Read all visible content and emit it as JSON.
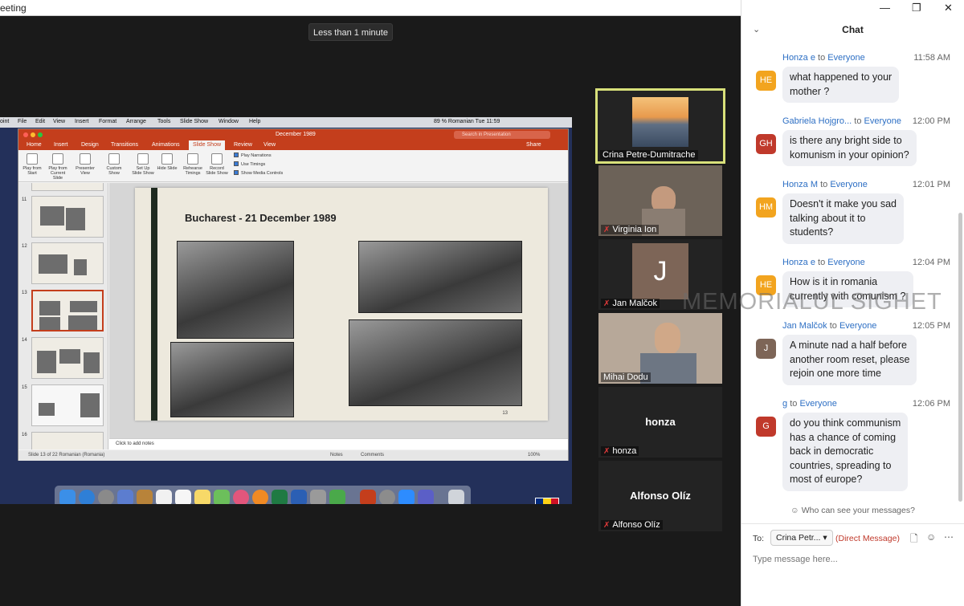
{
  "window": {
    "title": "eeting",
    "minimize": "—",
    "maximize": "❐",
    "close": "✕"
  },
  "timer": "Less than 1 minute",
  "share": {
    "mac_menu": [
      "oint",
      "File",
      "Edit",
      "View",
      "Insert",
      "Format",
      "Arrange",
      "Tools",
      "Slide Show",
      "Window",
      "Help"
    ],
    "mac_status": "89 %  Romanian   Tue 11:59",
    "ppt_title": "December 1989",
    "ppt_search": "Search in Presentation",
    "ppt_tabs": [
      "Home",
      "Insert",
      "Design",
      "Transitions",
      "Animations",
      "Slide Show",
      "Review",
      "View"
    ],
    "ppt_share": "Share",
    "ribbon": [
      "Play from Start",
      "Play from Current Slide",
      "Presenter View",
      "Custom Show",
      "Set Up Slide Show",
      "Hide Slide",
      "Rehearse Timings",
      "Record Slide Show"
    ],
    "checks": [
      "Play Narrations",
      "Use Timings",
      "Show Media Controls"
    ],
    "thumb_numbers": [
      "11",
      "12",
      "13",
      "14",
      "15",
      "16"
    ],
    "slide_title": "Bucharest - 21 December 1989",
    "slide_number": "13",
    "notes_placeholder": "Click to add notes",
    "status_left": "Slide 13 of 22     Romanian (Romania)",
    "status_notes": "Notes",
    "status_comments": "Comments",
    "zoom": "100%"
  },
  "tiles": [
    {
      "name": "Crina Petre-Dumitrache",
      "muted": false
    },
    {
      "name": "Virginia Ion",
      "muted": true
    },
    {
      "name": "Jan Malčok",
      "muted": true,
      "initial": "J"
    },
    {
      "name": "Mihai Dodu",
      "muted": false
    },
    {
      "name": "honza",
      "muted": true
    },
    {
      "name": "Alfonso Olíz",
      "muted": true
    }
  ],
  "chat": {
    "title": "Chat",
    "messages": [
      {
        "initials": "HE",
        "color": "#f2a41f",
        "from": "Honza e",
        "to": "Everyone",
        "time": "11:58 AM",
        "text": [
          "what happened to your",
          "mother ?"
        ]
      },
      {
        "initials": "GH",
        "color": "#c0392b",
        "from": "Gabriela Hojgro...",
        "to": "Everyone",
        "time": "12:00 PM",
        "text": [
          "is there any bright side to",
          "komunism in your opinion?"
        ]
      },
      {
        "initials": "HM",
        "color": "#f2a41f",
        "from": "Honza M",
        "to": "Everyone",
        "time": "12:01 PM",
        "text": [
          "Doesn't it make you sad",
          "talking about it to",
          "students?"
        ]
      },
      {
        "initials": "HE",
        "color": "#f2a41f",
        "from": "Honza e",
        "to": "Everyone",
        "time": "12:04 PM",
        "text": [
          "How is it in romania",
          "currently with comunism ?"
        ]
      },
      {
        "initials": "J",
        "color": "#7d6557",
        "from": "Jan Malčok",
        "to": "Everyone",
        "time": "12:05 PM",
        "text": [
          "A minute nad a half before",
          "another room reset, please",
          "rejoin one more time"
        ]
      },
      {
        "initials": "G",
        "color": "#c0392b",
        "from": "g",
        "to": "Everyone",
        "time": "12:06 PM",
        "text": [
          "do you think communism",
          "has a chance of coming",
          "back in democratic",
          "countries, spreading to",
          "most of europe?"
        ]
      }
    ],
    "to_word": "to",
    "who_can_see": "Who can see your messages?",
    "to_label": "To:",
    "recipient": "Crina Petr...",
    "direct_message": "(Direct Message)",
    "input_placeholder": "Type message here..."
  },
  "watermark": "MEMORIALUL SIGHET"
}
